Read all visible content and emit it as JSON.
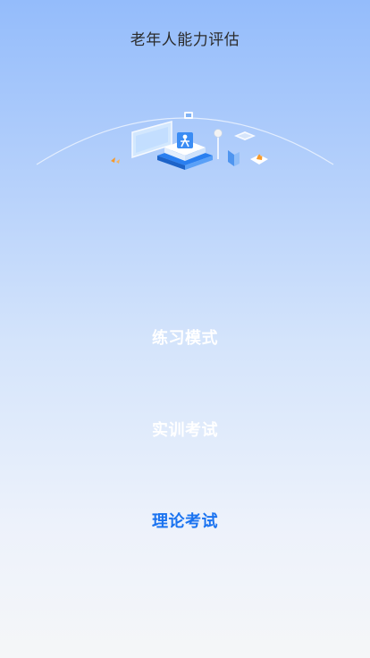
{
  "header": {
    "title": "老年人能力评估"
  },
  "menu": {
    "items": [
      {
        "label": "练习模式",
        "color": "#ffffff"
      },
      {
        "label": "实训考试",
        "color": "#ffffff"
      },
      {
        "label": "理论考试",
        "color": "#1a73f0"
      }
    ]
  },
  "colors": {
    "gradient_top": "#94bcfb",
    "gradient_bottom": "#f5f6f8",
    "accent": "#1a73f0",
    "hero_orange": "#f59a2c"
  },
  "icons": [
    "education-illustration"
  ]
}
